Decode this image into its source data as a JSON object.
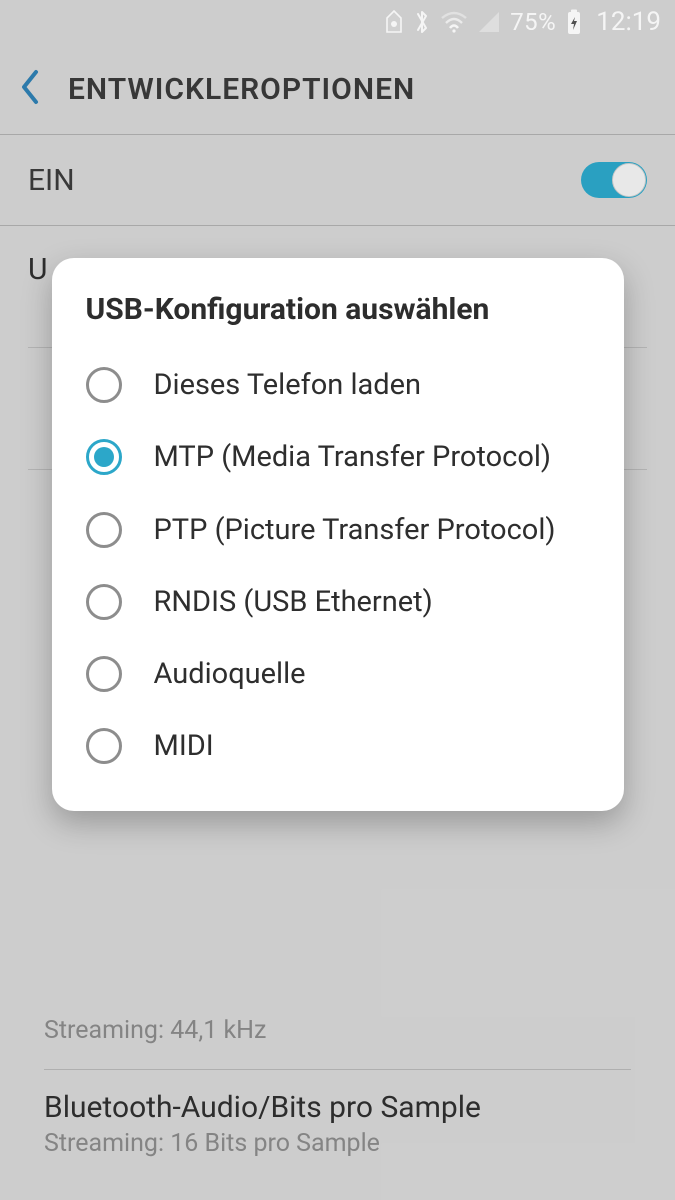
{
  "status": {
    "battery_pct": "75%",
    "time": "12:19"
  },
  "appbar": {
    "title": "ENTWICKLEROPTIONEN"
  },
  "master_toggle": {
    "label": "EIN",
    "on": true
  },
  "dialog": {
    "title": "USB-Konfiguration auswählen",
    "options": [
      {
        "label": "Dieses Telefon laden",
        "selected": false
      },
      {
        "label": "MTP (Media Transfer Protocol)",
        "selected": true
      },
      {
        "label": "PTP (Picture Transfer Protocol)",
        "selected": false
      },
      {
        "label": "RNDIS (USB Ethernet)",
        "selected": false
      },
      {
        "label": "Audioquelle",
        "selected": false
      },
      {
        "label": "MIDI",
        "selected": false
      }
    ]
  },
  "bg_visible": {
    "row1": {
      "sub": "Streaming: 44,1 kHz"
    },
    "row2": {
      "title": "Bluetooth-Audio/Bits pro Sample",
      "sub": "Streaming: 16 Bits pro Sample"
    }
  }
}
